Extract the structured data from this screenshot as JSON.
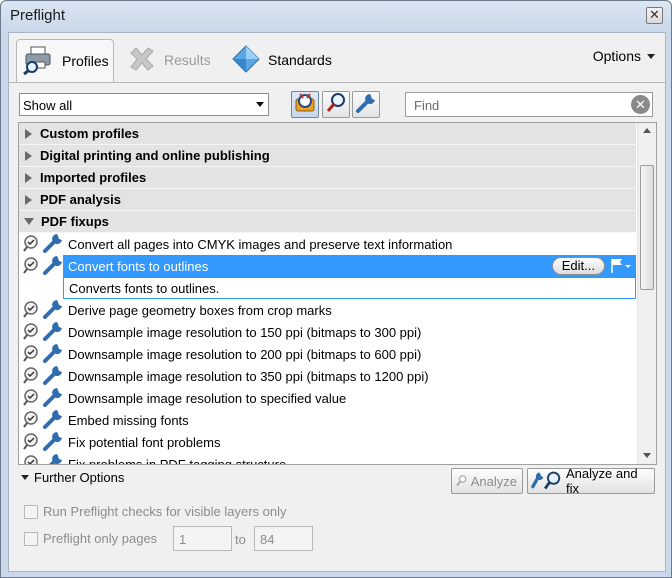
{
  "window": {
    "title": "Preflight",
    "close_glyph": "✕"
  },
  "tabs": [
    {
      "label": "Profiles",
      "icon": "printer-magnifier-icon",
      "active": true
    },
    {
      "label": "Results",
      "icon": "results-icon",
      "active": false
    },
    {
      "label": "Standards",
      "icon": "diamond-icon",
      "active": false
    }
  ],
  "options_label": "Options",
  "toolbar": {
    "filter_value": "Show all",
    "find_placeholder": "Find",
    "buttons": [
      "profile-icon",
      "inspect-icon",
      "fixup-icon"
    ]
  },
  "tree": {
    "groups": [
      "Custom profiles",
      "Digital printing and online publishing",
      "Imported profiles",
      "PDF analysis",
      "PDF fixups"
    ],
    "items": [
      "Convert all pages into CMYK images and preserve text information",
      "Convert fonts to outlines",
      "Derive page geometry boxes from crop marks",
      "Downsample image resolution to 150 ppi (bitmaps to 300 ppi)",
      "Downsample image resolution to 200 ppi (bitmaps to 600 ppi)",
      "Downsample image resolution to 350 ppi (bitmaps to 1200 ppi)",
      "Downsample image resolution to specified value",
      "Embed missing fonts",
      "Fix potential font problems",
      "Fix problems in PDF tagging structure"
    ],
    "selected_description": "Converts fonts to outlines.",
    "edit_label": "Edit..."
  },
  "further_options_label": "Further Options",
  "analyze_label": "Analyze",
  "analyze_fix_label": "Analyze and fix",
  "options": {
    "visible_layers_label": "Run Preflight checks for visible layers only",
    "pages_label": "Preflight only pages",
    "from_page": "1",
    "to_label": "to",
    "to_page": "84"
  },
  "colors": {
    "selection": "#3399ff",
    "wrench": "#2f6db0"
  }
}
